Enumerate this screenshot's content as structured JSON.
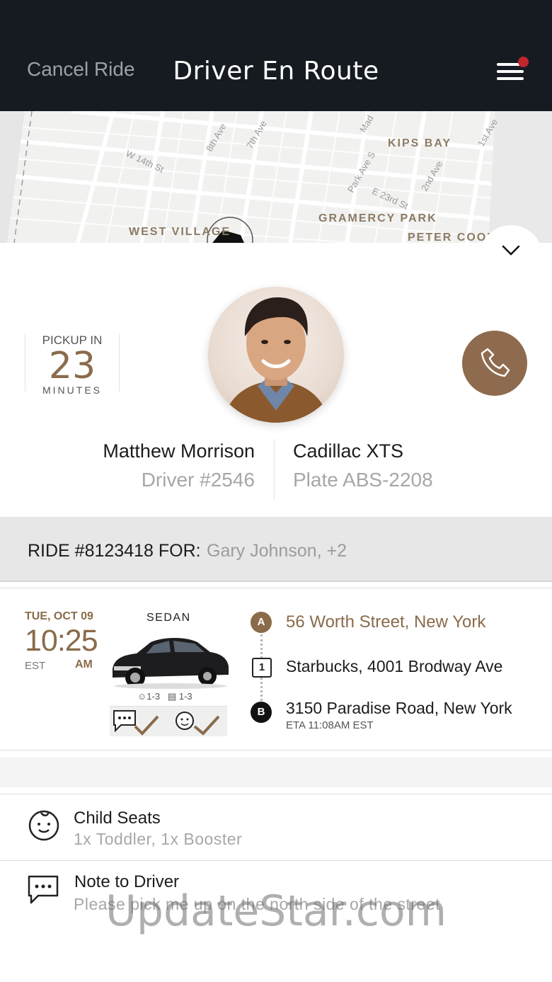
{
  "header": {
    "cancel_label": "Cancel Ride",
    "title": "Driver En Route"
  },
  "map": {
    "labels": [
      "KIPS BAY",
      "GRAMERCY PARK",
      "WEST VILLAGE",
      "PETER COOP"
    ],
    "streets": [
      "W 14th St",
      "8th Ave",
      "7th Ave",
      "Park Ave S",
      "E 23rd St",
      "2nd Ave",
      "1st Ave",
      "Mad"
    ]
  },
  "pickup": {
    "label": "PICKUP IN",
    "value": "23",
    "unit": "MINUTES"
  },
  "driver": {
    "name": "Matthew Morrison",
    "number": "Driver #2546"
  },
  "vehicle": {
    "model": "Cadillac XTS",
    "plate": "Plate ABS-2208"
  },
  "ride": {
    "id_label": "RIDE #8123418 FOR:",
    "passengers": "Gary Johnson, +2"
  },
  "trip": {
    "date": "TUE, OCT 09",
    "time": "10:25",
    "tz": "EST",
    "ampm": "AM",
    "vehicle_class": "SEDAN",
    "passengers_cap": "1-3",
    "luggage_cap": "1-3",
    "stops": [
      {
        "marker": "A",
        "address": "56 Worth Street, New York"
      },
      {
        "marker": "1",
        "address": "Starbucks, 4001 Brodway Ave"
      },
      {
        "marker": "B",
        "address": "3150 Paradise Road, New York"
      }
    ],
    "eta": "ETA  11:08AM EST"
  },
  "details": {
    "child_seats_title": "Child Seats",
    "child_seats_value": "1x Toddler, 1x Booster",
    "note_title": "Note to Driver",
    "note_value": "Please pick me up on the north side of the street"
  },
  "watermark": "UpdateStar.com",
  "colors": {
    "header_bg": "#161b21",
    "accent": "#8a6b4a",
    "notification": "#c0262d"
  }
}
